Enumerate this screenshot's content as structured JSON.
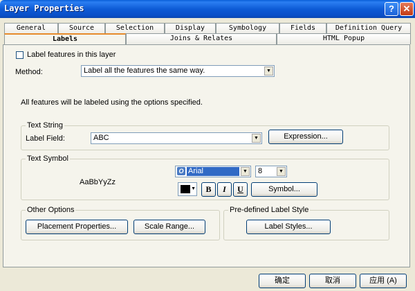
{
  "window": {
    "title": "Layer Properties",
    "help_glyph": "?",
    "close_glyph": "✕"
  },
  "tabs_back": [
    "General",
    "Source",
    "Selection",
    "Display",
    "Symbology",
    "Fields",
    "Definition Query"
  ],
  "tabs_front": [
    "Labels",
    "Joins & Relates",
    "HTML Popup"
  ],
  "active_tab": "Labels",
  "labels": {
    "checkbox_label": "Label features in this layer",
    "checkbox_checked": false,
    "method_label": "Method:",
    "method_value": "Label all the features the same way.",
    "info_text": "All features will be labeled using the options specified.",
    "text_string": {
      "group_title": "Text String",
      "field_label": "Label Field:",
      "field_value": "ABC",
      "expression_button": "Expression..."
    },
    "text_symbol": {
      "group_title": "Text Symbol",
      "sample_text": "AaBbYyZz",
      "font_value": "Arial",
      "font_icon": "O",
      "size_value": "8",
      "color": "#000000",
      "bold": "B",
      "italic": "I",
      "underline": "U",
      "symbol_button": "Symbol..."
    },
    "other_options": {
      "group_title": "Other Options",
      "placement_button": "Placement Properties...",
      "scale_button": "Scale Range..."
    },
    "predefined": {
      "group_title": "Pre-defined Label Style",
      "label_styles_button": "Label Styles..."
    }
  },
  "footer": {
    "ok": "确定",
    "cancel": "取消",
    "apply": "应用 (A)"
  },
  "colors": {
    "title_bar": "#0a5fd8",
    "dialog_bg": "#ece9d8",
    "panel_bg": "#f5f4ec",
    "active_tab_accent": "#e68b2c",
    "selection": "#316ac5"
  }
}
